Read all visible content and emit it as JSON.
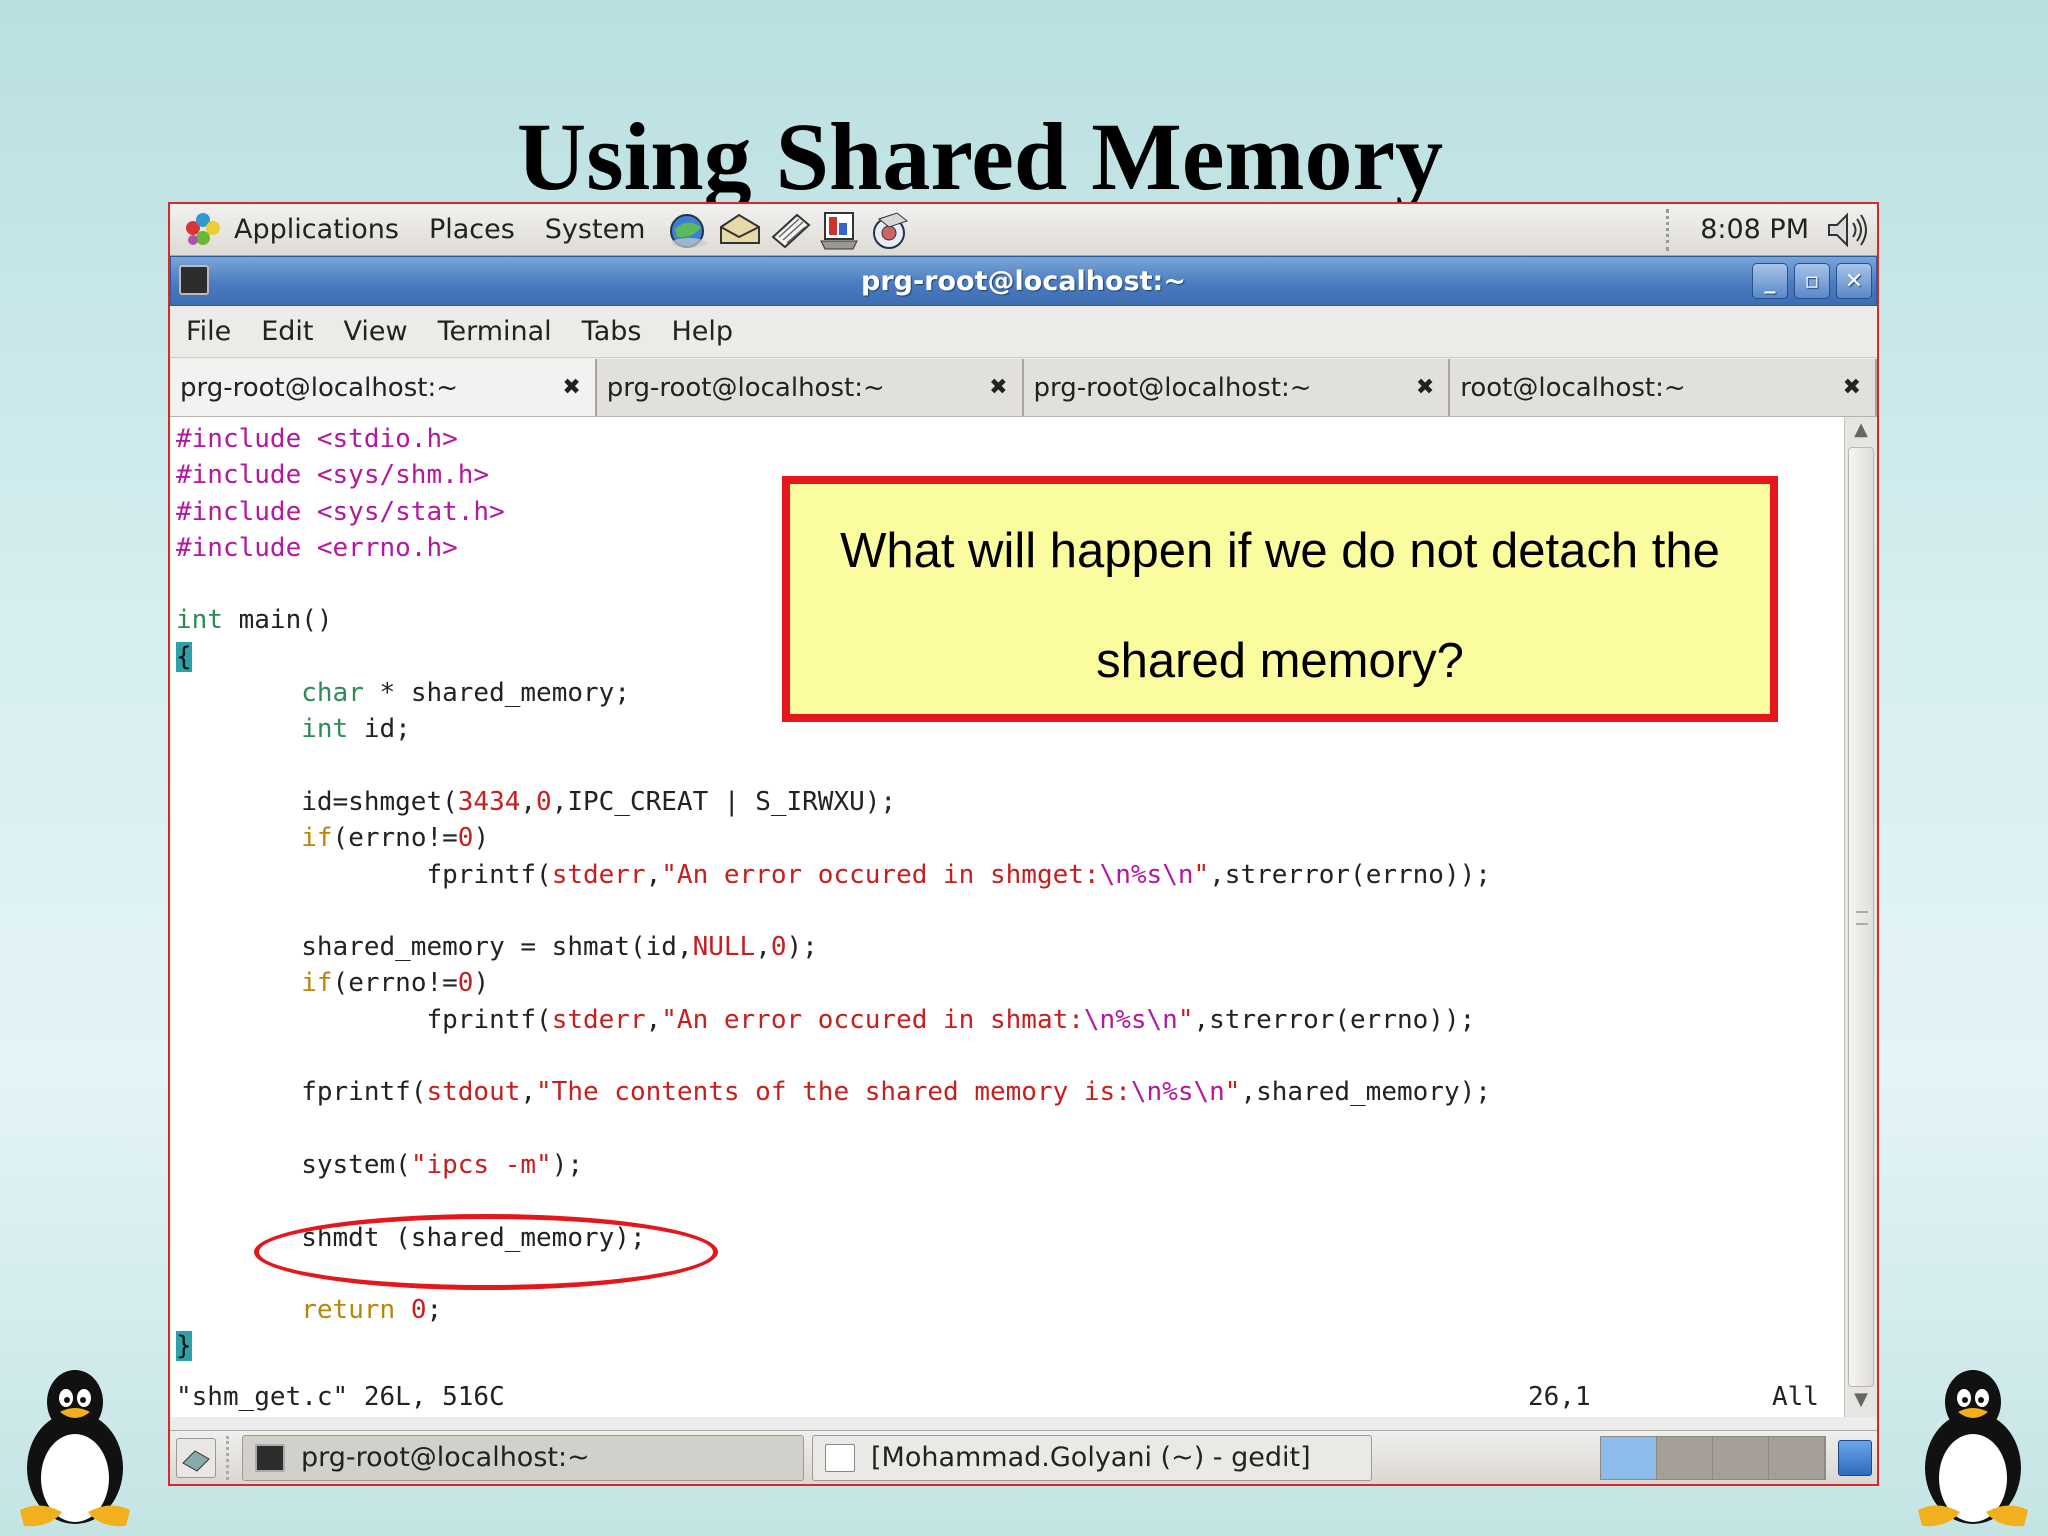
{
  "slide": {
    "title": "Using Shared Memory"
  },
  "top_panel": {
    "menus": [
      "Applications",
      "Places",
      "System"
    ],
    "launchers": [
      "web-browser-icon",
      "email-icon",
      "text-editor-icon",
      "presentation-icon",
      "help-icon"
    ],
    "clock": "8:08 PM",
    "volume_icon": "speaker-icon"
  },
  "window": {
    "title": "prg-root@localhost:~",
    "controls": [
      "minimize",
      "maximize",
      "close"
    ]
  },
  "menubar": [
    "File",
    "Edit",
    "View",
    "Terminal",
    "Tabs",
    "Help"
  ],
  "tabs": [
    {
      "label": "prg-root@localhost:~",
      "active": true
    },
    {
      "label": "prg-root@localhost:~",
      "active": false
    },
    {
      "label": "prg-root@localhost:~",
      "active": false
    },
    {
      "label": "root@localhost:~",
      "active": false
    }
  ],
  "code": {
    "lines": [
      "#include <stdio.h>",
      "#include <sys/shm.h>",
      "#include <sys/stat.h>",
      "#include <errno.h>",
      "",
      "int main()",
      "{",
      "        char * shared_memory;",
      "        int id;",
      "",
      "        id=shmget(3434,0,IPC_CREAT | S_IRWXU);",
      "        if(errno!=0)",
      "                fprintf(stderr,\"An error occured in shmget:\\n%s\\n\",strerror(errno));",
      "",
      "        shared_memory = shmat(id,NULL,0);",
      "        if(errno!=0)",
      "                fprintf(stderr,\"An error occured in shmat:\\n%s\\n\",strerror(errno));",
      "",
      "        fprintf(stdout,\"The contents of the shared memory is:\\n%s\\n\",shared_memory);",
      "",
      "        system(\"ipcs -m\");",
      "",
      "        shmdt (shared_memory);",
      "",
      "        return 0;",
      "}"
    ]
  },
  "status_line": {
    "file": "\"shm_get.c\" 26L, 516C",
    "position": "26,1",
    "scroll": "All"
  },
  "callout": {
    "line1": "What will happen if we do not detach the",
    "line2": "shared memory?"
  },
  "bottom_panel": {
    "tasks": [
      "prg-root@localhost:~",
      "[Mohammad.Golyani (~) - gedit]"
    ],
    "workspaces": 4,
    "active_workspace": 1
  },
  "colors": {
    "preprocessor": "#b5179e",
    "type": "#2e8b57",
    "keyword": "#b8860b",
    "string": "#c81e1e",
    "callout_bg": "#fbfba0",
    "callout_border": "#e4181c",
    "titlebar": "#4b7cc0"
  }
}
